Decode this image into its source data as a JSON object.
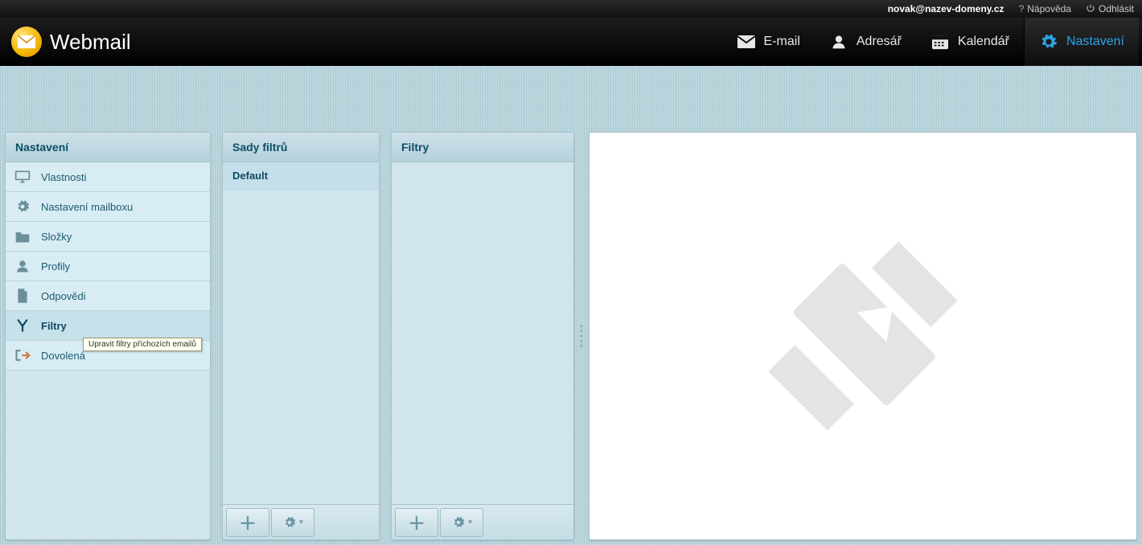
{
  "utility": {
    "user": "novak@nazev-domeny.cz",
    "help": "Nápověda",
    "logout": "Odhlásit"
  },
  "logo_text": "Webmail",
  "nav": [
    {
      "id": "email",
      "label": "E-mail",
      "active": false
    },
    {
      "id": "contacts",
      "label": "Adresář",
      "active": false
    },
    {
      "id": "calendar",
      "label": "Kalendář",
      "active": false
    },
    {
      "id": "settings",
      "label": "Nastavení",
      "active": true
    }
  ],
  "settings_panel": {
    "title": "Nastavení",
    "items": [
      {
        "id": "preferences",
        "label": "Vlastnosti",
        "icon": "monitor",
        "selected": false
      },
      {
        "id": "mailbox",
        "label": "Nastavení mailboxu",
        "icon": "gear",
        "selected": false
      },
      {
        "id": "folders",
        "label": "Složky",
        "icon": "folder",
        "selected": false
      },
      {
        "id": "profiles",
        "label": "Profily",
        "icon": "person",
        "selected": false
      },
      {
        "id": "responses",
        "label": "Odpovědi",
        "icon": "doc",
        "selected": false
      },
      {
        "id": "filters",
        "label": "Filtry",
        "icon": "filter",
        "selected": true
      },
      {
        "id": "vacation",
        "label": "Dovolená",
        "icon": "arrowout",
        "selected": false
      }
    ]
  },
  "filter_sets_panel": {
    "title": "Sady filtrů",
    "items": [
      {
        "id": "default",
        "label": "Default",
        "selected": true
      }
    ]
  },
  "filters_panel": {
    "title": "Filtry",
    "items": []
  },
  "tooltip_text": "Upravit filtry příchozích emailů",
  "colors": {
    "accent": "#2aa3e6",
    "panel_bg": "#d1e5ec",
    "heading": "#0d4f66"
  }
}
